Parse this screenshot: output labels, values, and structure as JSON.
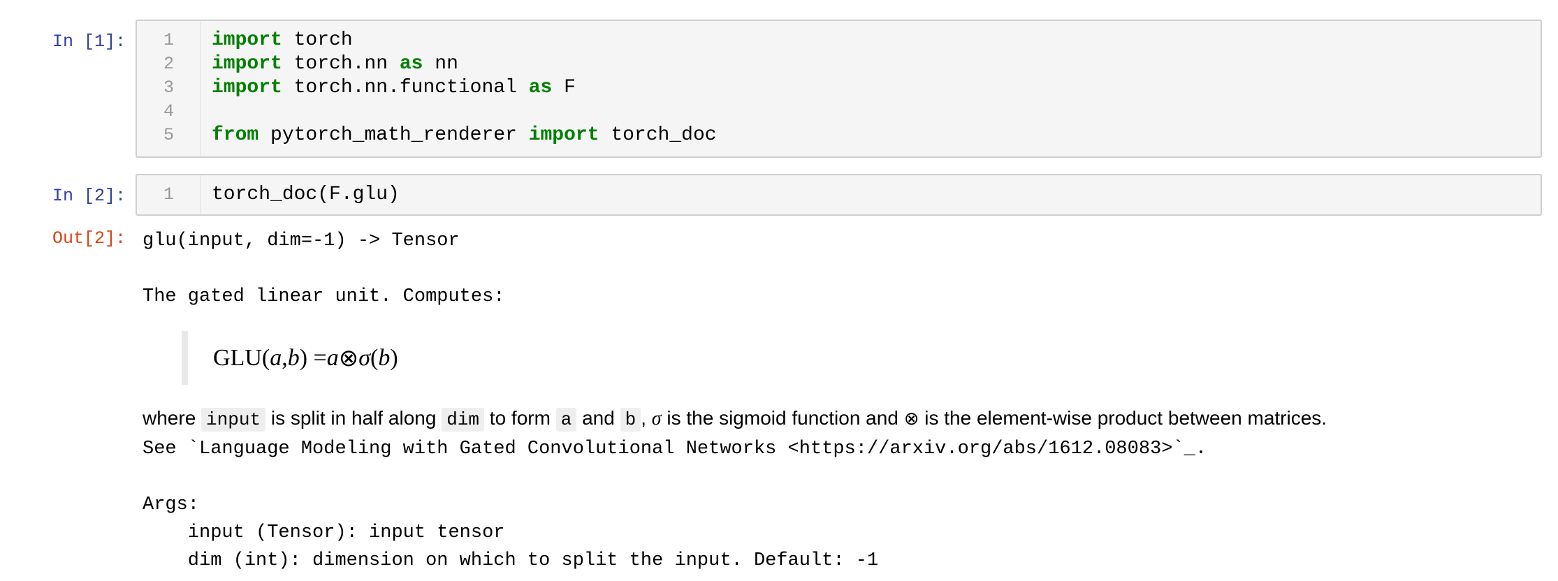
{
  "cells": [
    {
      "prompt": "In [1]:",
      "lines": [
        {
          "number": "1",
          "keyword": "import",
          "text": " torch",
          "keyword2": "",
          "text2": ""
        },
        {
          "number": "2",
          "keyword": "import",
          "text": " torch.nn ",
          "keyword2": "as",
          "text2": " nn"
        },
        {
          "number": "3",
          "keyword": "import",
          "text": " torch.nn.functional ",
          "keyword2": "as",
          "text2": " F"
        },
        {
          "number": "4",
          "keyword": "",
          "text": "",
          "keyword2": "",
          "text2": ""
        },
        {
          "number": "5",
          "keyword": "from",
          "text": " pytorch_math_renderer ",
          "keyword2": "import",
          "text2": " torch_doc"
        }
      ]
    },
    {
      "prompt": "In [2]:",
      "lines": [
        {
          "number": "1",
          "text": "torch_doc(F.glu)"
        }
      ]
    }
  ],
  "output": {
    "prompt": "Out[2]:",
    "signature": "glu(input, dim=-1) -> Tensor",
    "summary": "The gated linear unit. Computes:",
    "formula": {
      "lhs": "GLU(",
      "a": "a",
      "comma": ", ",
      "b": "b",
      "rhs_open": ") = ",
      "a2": "a",
      "op": " ⊗ ",
      "sigma": "σ",
      "paren_open": "(",
      "b2": "b",
      "paren_close": ")"
    },
    "where_sentence": {
      "t1": "where ",
      "c1": "input",
      "t2": " is split in half along ",
      "c2": "dim",
      "t3": " to form ",
      "c3": "a",
      "t4": " and ",
      "c4": "b",
      "t5": ", ",
      "sigma": "σ",
      "t6": " is the sigmoid function and ",
      "otimes": "⊗",
      "t7": " is the element-wise product between matrices."
    },
    "see_line": "See `Language Modeling with Gated Convolutional Networks <https://arxiv.org/abs/1612.08083>`_.",
    "args_header": "Args:",
    "args": [
      "    input (Tensor): input tensor",
      "    dim (int): dimension on which to split the input. Default: -1"
    ]
  }
}
